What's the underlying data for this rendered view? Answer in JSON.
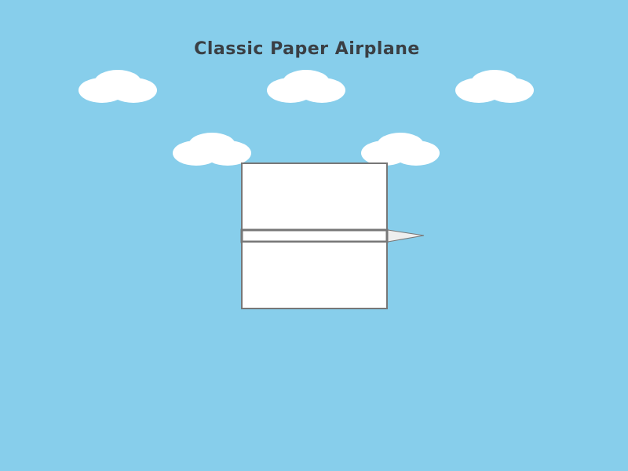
{
  "title": "Classic Paper Airplane",
  "colors": {
    "sky": "#87CEEB",
    "cloud": "#FFFFFF",
    "paper": "#FFFFFF",
    "paper_edge": "#777777",
    "nose": "#EEEEEE",
    "title": "#3A3F44"
  },
  "icons": {
    "cloud": "cloud-icon",
    "airplane": "paper-airplane-icon"
  }
}
